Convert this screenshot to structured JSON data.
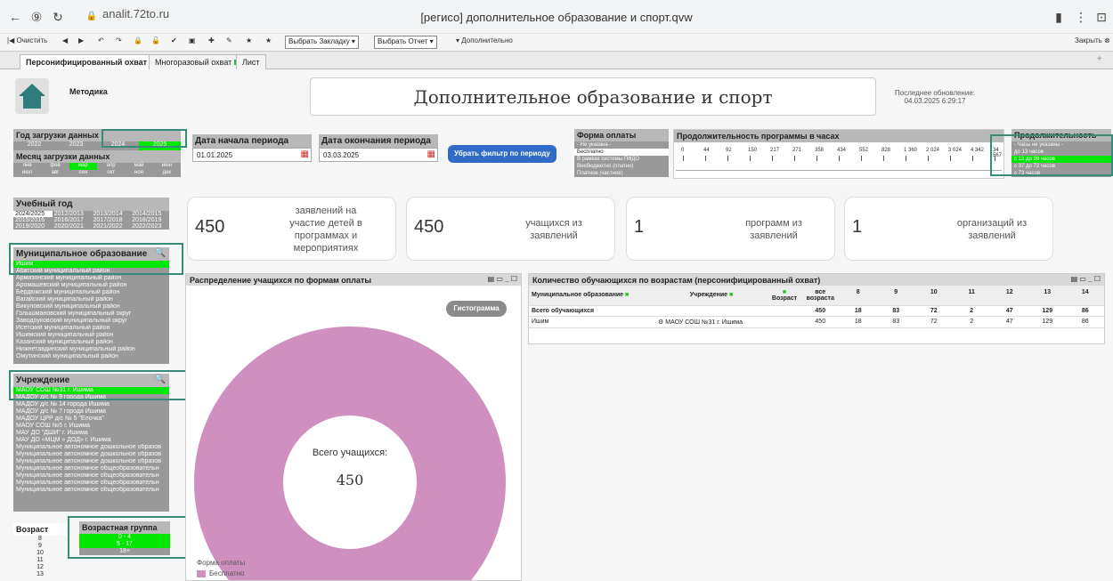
{
  "browser": {
    "url": "analit.72to.ru",
    "title": "[регисо] дополнительное образование и спорт.qvw"
  },
  "toolbar": {
    "clear": "Очистить",
    "bookmark_select": "Выбрать Закладку",
    "report_select": "Выбрать Отчет",
    "extra": "Дополнительно",
    "close": "Закрыть"
  },
  "tabs": [
    {
      "label": "Персонифицированный охват"
    },
    {
      "label": "Многоразовый охват"
    },
    {
      "label": "Лист"
    }
  ],
  "header": {
    "methodology": "Методика",
    "title": "Дополнительное образование и спорт",
    "updated_label": "Последнее обновление:",
    "updated_value": "04.03.2025 6:29:17"
  },
  "filters": {
    "year_load_label": "Год загрузки данных",
    "years": [
      "2022",
      "2023",
      "2024",
      "2025"
    ],
    "month_load_label": "Месяц загрузки данных",
    "months": [
      "янв",
      "фев",
      "мар",
      "апр",
      "май",
      "июн"
    ],
    "months2": [
      "июл",
      "авг",
      "сен",
      "окт",
      "ноя",
      "дек"
    ],
    "start_label": "Дата начала периода",
    "start_value": "01.01.2025",
    "end_label": "Дата окончания периода",
    "end_value": "03.03.2025",
    "remove_filter": "Убрать фильтр по периоду",
    "payment_label": "Форма оплаты",
    "payment_items": [
      "- Не указана -",
      "Бесплатно",
      "В рамках системы ПФДО",
      "Внебюджетно (платно)",
      "Платное (частное)"
    ],
    "duration_label": "Продолжительность программы в часах",
    "duration_ticks": [
      "0",
      "44",
      "92",
      "150",
      "217",
      "271",
      "358",
      "434",
      "552",
      "828",
      "1 360",
      "2 024",
      "3 024",
      "4 342",
      "34 567"
    ],
    "duration2_label": "Продолжительность",
    "duration2_items": [
      "- Часы не указаны -",
      "до 13 часов",
      "с 13 до 36 часов",
      "с 37 до 72 часов",
      "с 73 часов"
    ]
  },
  "left": {
    "school_year_label": "Учебный год",
    "school_years": [
      "2024/2025",
      "2012/2013",
      "2013/2014",
      "2014/2015",
      "2015/2016",
      "2016/2017",
      "2017/2018",
      "2018/2019",
      "2019/2020",
      "2020/2021",
      "2021/2022",
      "2022/2023"
    ],
    "municipal_label": "Муниципальное образование",
    "municipal_items": [
      "Ишим",
      "Абатский муниципальный район",
      "Армизонский муниципальный район",
      "Аромашевский муниципальный район",
      "Бердюжский муниципальный район",
      "Вагайский муниципальный район",
      "Викуловский муниципальный район",
      "Голышмановский муниципальный округ",
      "Заводоуковский муниципальный округ",
      "Исетский муниципальный район",
      "Ишимский муниципальный район",
      "Казанский муниципальный район",
      "Нижнетавдинский муниципальный район",
      "Омутинский муниципальный район"
    ],
    "institution_label": "Учреждение",
    "institution_items": [
      "МАОУ СОШ №31 г. Ишима",
      "МАДОУ д/с № 9 города Ишима",
      "МАДОУ д/с № 14 города Ишима",
      "МАДОУ д/с № 7 города Ишима",
      "МАДОУ ЦРР д/с № 5 \"Елочка\"",
      "МАОУ СОШ №5 г. Ишима",
      "МАУ ДО \"ДШИ\" г. Ишима",
      "МАУ ДО «МЦМ » ДОД» г. Ишима",
      "Муниципальное автономное дошкольное образов",
      "Муниципальное автономное дошкольное образов",
      "Муниципальное автономное дошкольное образов",
      "Муниципальное автономное общеобразовательн",
      "Муниципальное автономное общеобразовательн",
      "Муниципальное автономное общеобразовательн",
      "Муниципальное автономное общеобразовательн"
    ],
    "age_label": "Возраст",
    "ages": [
      "8",
      "9",
      "10",
      "11",
      "12",
      "13"
    ],
    "age_group_label": "Возрастная группа",
    "age_groups": [
      "0 - 4",
      "5 - 17",
      "18+"
    ]
  },
  "kpis": [
    {
      "value": "450",
      "label": "заявлений на участие детей в программах и мероприятиях"
    },
    {
      "value": "450",
      "label": "учащихся из заявлений"
    },
    {
      "value": "1",
      "label": "программ из заявлений"
    },
    {
      "value": "1",
      "label": "организаций из заявлений"
    }
  ],
  "donut": {
    "title": "Распределение учащихся по формам оплаты",
    "button": "Гистограмма",
    "center_label": "Всего учащихся:",
    "center_value": "450",
    "legend_title": "Форма оплаты",
    "legend_item": "Бесплатно",
    "color": "#cf8fbf"
  },
  "table": {
    "title": "Количество обучающихся по возрастам (персонифицированный охват)",
    "col_municipal": "Муниципальное образование",
    "col_institution": "Учреждение",
    "col_age": "Возраст",
    "age_cols": [
      "все возраста",
      "8",
      "9",
      "10",
      "11",
      "12",
      "13",
      "14"
    ],
    "total_label": "Всего обучающихся",
    "total_values": [
      "450",
      "18",
      "83",
      "72",
      "2",
      "47",
      "129",
      "86"
    ],
    "row_municipal": "Ишим",
    "row_institution": "МАОУ СОШ №31 г. Ишима",
    "row_values": [
      "450",
      "18",
      "83",
      "72",
      "2",
      "47",
      "129",
      "86"
    ]
  }
}
